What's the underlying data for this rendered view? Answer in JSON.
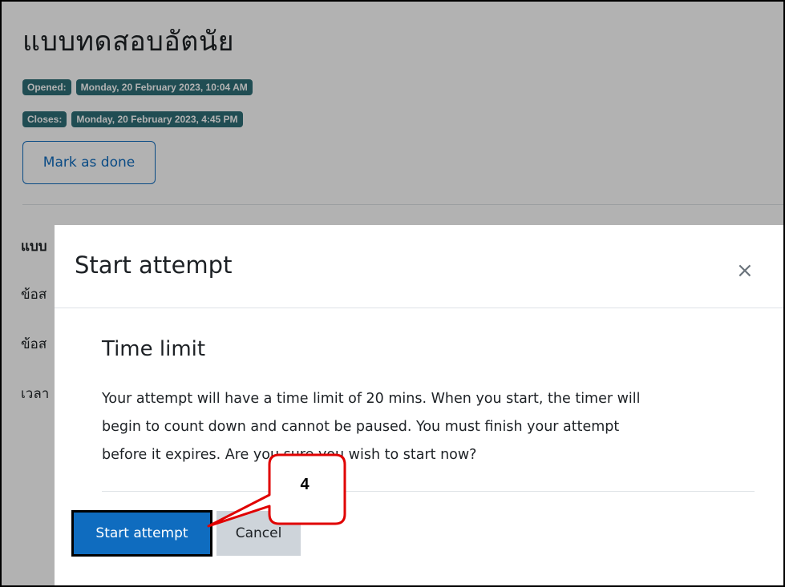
{
  "page": {
    "title": "แบบทดสอบอัตนัย",
    "opened_label": "Opened:",
    "opened_value": "Monday, 20 February 2023, 10:04 AM",
    "closes_label": "Closes:",
    "closes_value": "Monday, 20 February 2023, 4:45 PM",
    "mark_done": "Mark as done",
    "partial_lines": [
      "แบบ",
      "ข้อส",
      "ข้อส",
      "เวลา"
    ]
  },
  "modal": {
    "title": "Start attempt",
    "close_glyph": "×",
    "section_title": "Time limit",
    "body_lines": [
      "Your attempt will have a time limit of 20 mins. When you start, the timer will",
      "begin to count down and cannot be paused. You must finish your attempt",
      "before it expires. Are you sure you wish to start now?"
    ],
    "start_label": "Start attempt",
    "cancel_label": "Cancel"
  },
  "annotation": {
    "step_number": "4",
    "color": "#e00000"
  },
  "colors": {
    "primary": "#0f6cbf",
    "badge": "#2f6f78",
    "secondary": "#ced4da"
  }
}
